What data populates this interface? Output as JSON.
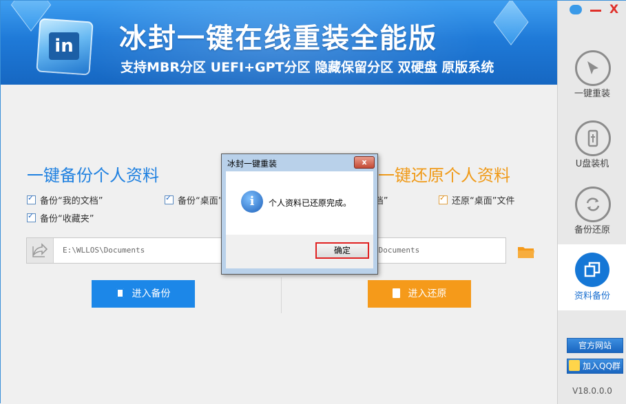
{
  "window": {
    "app_title": "冰封一键在线重装全能版",
    "app_subtitle": "支持MBR分区  UEFI+GPT分区  隐藏保留分区  双硬盘  原版系统",
    "logo_text": "in"
  },
  "title_controls": {
    "chat_icon": "chat-bubble",
    "minimize_label": "—",
    "close_label": "X"
  },
  "sidebar": {
    "items": [
      {
        "label": "一键重装",
        "icon": "cursor-icon",
        "active": false
      },
      {
        "label": "U盘装机",
        "icon": "usb-icon",
        "active": false
      },
      {
        "label": "备份还原",
        "icon": "refresh-icon",
        "active": false
      },
      {
        "label": "资料备份",
        "icon": "copy-icon",
        "active": true
      }
    ],
    "website_button": "官方网站",
    "qq_button": "加入QQ群",
    "version": "V18.0.0.0"
  },
  "backup": {
    "title": "一键备份个人资料",
    "checkboxes": [
      "备份“我的文档”",
      "备份“桌面”文件",
      "备份“收藏夹”"
    ],
    "path": "E:\\WLLOS\\Documents",
    "button": "进入备份"
  },
  "restore": {
    "title": "一键还原个人资料",
    "checkboxes": [
      "还原“我的文档”",
      "还原“桌面”文件"
    ],
    "path": "E:\\WLLOS\\Documents",
    "button": "进入还原"
  },
  "dialog": {
    "title": "冰封一键重装",
    "message": "个人资料已还原完成。",
    "ok_button": "确定",
    "close_label": "x"
  },
  "colors": {
    "accent_blue": "#1c87e8",
    "accent_orange": "#f59a1a",
    "banner_blue": "#1f7ad8"
  }
}
